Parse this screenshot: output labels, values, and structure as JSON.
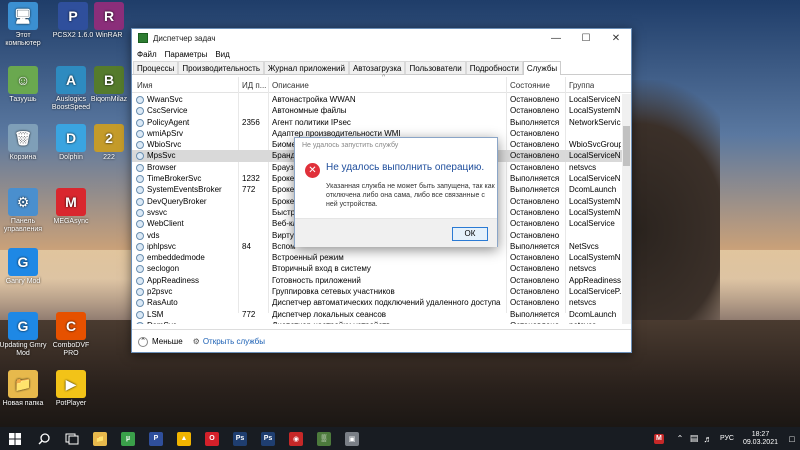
{
  "desktop": {
    "icons": [
      {
        "label": "Этот компьютер",
        "glyph": "🖥",
        "color": "#3b8fd1"
      },
      {
        "label": "PCSX2 1.6.0",
        "glyph": "P",
        "color": "#2f4f9c"
      },
      {
        "label": "WinRAR",
        "glyph": "R",
        "color": "#8b2e7a"
      },
      {
        "label": "Тазуушь",
        "glyph": "☺",
        "color": "#6aa84f"
      },
      {
        "label": "Auslogics BoostSpeed",
        "glyph": "A",
        "color": "#2e8bc0"
      },
      {
        "label": "BiqomMilaz",
        "glyph": "B",
        "color": "#557b2c"
      },
      {
        "label": "Корзина",
        "glyph": "🗑",
        "color": "#7f9fb8"
      },
      {
        "label": "Dolphin",
        "glyph": "D",
        "color": "#3aa4e0"
      },
      {
        "label": "222",
        "glyph": "2",
        "color": "#c49b2a"
      },
      {
        "label": "Панель управления",
        "glyph": "⚙",
        "color": "#4a8fce"
      },
      {
        "label": "MEGAsync",
        "glyph": "M",
        "color": "#d9272e"
      },
      {
        "label": "Ganry Mod",
        "glyph": "G",
        "color": "#1e88e5"
      },
      {
        "label": "Updating Gmry Mod",
        "glyph": "G",
        "color": "#1e88e5"
      },
      {
        "label": "ComboDVF PRO",
        "glyph": "C",
        "color": "#e65100"
      },
      {
        "label": "Новая папка",
        "glyph": "📁",
        "color": "#e7b94c"
      },
      {
        "label": "PotPlayer",
        "glyph": "▶",
        "color": "#f2c318"
      }
    ]
  },
  "window": {
    "title": "Диспетчер задач",
    "menu": [
      "Файл",
      "Параметры",
      "Вид"
    ],
    "tabs": [
      "Процессы",
      "Производительность",
      "Журнал приложений",
      "Автозагрузка",
      "Пользователи",
      "Подробности",
      "Службы"
    ],
    "active_tab": "Службы",
    "columns": {
      "name": "Имя",
      "pid": "ИД п...",
      "desc": "Описание",
      "state": "Состояние",
      "group": "Группа"
    },
    "rows": [
      {
        "name": "WwanSvc",
        "pid": "",
        "desc": "Автонастройка WWAN",
        "state": "Остановлено",
        "group": "LocalServiceN..."
      },
      {
        "name": "CscService",
        "pid": "",
        "desc": "Автономные файлы",
        "state": "Остановлено",
        "group": "LocalSystemN..."
      },
      {
        "name": "PolicyAgent",
        "pid": "2356",
        "desc": "Агент политики IPsec",
        "state": "Выполняется",
        "group": "NetworkServic..."
      },
      {
        "name": "wmiApSrv",
        "pid": "",
        "desc": "Адаптер производительности WMI",
        "state": "Остановлено",
        "group": ""
      },
      {
        "name": "WbioSrvc",
        "pid": "",
        "desc": "Биоме",
        "state": "Остановлено",
        "group": "WbioSvcGroup"
      },
      {
        "name": "MpsSvc",
        "pid": "",
        "desc": "Брандм",
        "state": "Остановлено",
        "group": "LocalServiceN..."
      },
      {
        "name": "Browser",
        "pid": "",
        "desc": "Браузер",
        "state": "Остановлено",
        "group": "netsvcs"
      },
      {
        "name": "TimeBrokerSvc",
        "pid": "1232",
        "desc": "Брокер",
        "state": "Выполняется",
        "group": "LocalServiceN..."
      },
      {
        "name": "SystemEventsBroker",
        "pid": "772",
        "desc": "Брокер",
        "state": "Выполняется",
        "group": "DcomLaunch"
      },
      {
        "name": "DevQueryBroker",
        "pid": "",
        "desc": "Брокер",
        "state": "Остановлено",
        "group": "LocalSystemN..."
      },
      {
        "name": "svsvc",
        "pid": "",
        "desc": "Быстра",
        "state": "Остановлено",
        "group": "LocalSystemN..."
      },
      {
        "name": "WebClient",
        "pid": "",
        "desc": "Веб-кл",
        "state": "Остановлено",
        "group": "LocalService"
      },
      {
        "name": "vds",
        "pid": "",
        "desc": "Вирту",
        "state": "Остановлено",
        "group": ""
      },
      {
        "name": "iphlpsvc",
        "pid": "84",
        "desc": "Вспом",
        "state": "Выполняется",
        "group": "NetSvcs"
      },
      {
        "name": "embeddedmode",
        "pid": "",
        "desc": "Встроенный режим",
        "state": "Остановлено",
        "group": "LocalSystemN..."
      },
      {
        "name": "seclogon",
        "pid": "",
        "desc": "Вторичный вход в систему",
        "state": "Остановлено",
        "group": "netsvcs"
      },
      {
        "name": "AppReadiness",
        "pid": "",
        "desc": "Готовность приложений",
        "state": "Остановлено",
        "group": "AppReadiness"
      },
      {
        "name": "p2psvc",
        "pid": "",
        "desc": "Группировка сетевых участников",
        "state": "Остановлено",
        "group": "LocalServiceP..."
      },
      {
        "name": "RasAuto",
        "pid": "",
        "desc": "Диспетчер автоматических подключений удаленного доступа",
        "state": "Остановлено",
        "group": "netsvcs"
      },
      {
        "name": "LSM",
        "pid": "772",
        "desc": "Диспетчер локальных сеансов",
        "state": "Выполняется",
        "group": "DcomLaunch"
      },
      {
        "name": "DsmSvc",
        "pid": "",
        "desc": "Диспетчер настройки устройств",
        "state": "Остановлено",
        "group": "netsvcs"
      }
    ],
    "selected_row": 5,
    "footer": {
      "less": "Меньше",
      "open_services": "Открыть службы"
    }
  },
  "dialog": {
    "title": "Не удалось запустить службу",
    "heading": "Не удалось выполнить операцию.",
    "message": "Указанная служба не может быть запущена, так как отключена либо она сама, либо все связанные с ней устройства.",
    "ok": "ОК"
  },
  "taskbar": {
    "apps": [
      {
        "name": "file-explorer",
        "glyph": "📁",
        "color": "#e7b94c"
      },
      {
        "name": "utorrent",
        "glyph": "µ",
        "color": "#3aa04a"
      },
      {
        "name": "pcsx2",
        "glyph": "P",
        "color": "#2f4f9c"
      },
      {
        "name": "app-yellow",
        "glyph": "▲",
        "color": "#f0b400"
      },
      {
        "name": "opera",
        "glyph": "O",
        "color": "#d4202a"
      },
      {
        "name": "photoshop-1",
        "glyph": "Ps",
        "color": "#1f3e70"
      },
      {
        "name": "photoshop-2",
        "glyph": "Ps",
        "color": "#1f3e70"
      },
      {
        "name": "red-app",
        "glyph": "◉",
        "color": "#c62828"
      },
      {
        "name": "task-manager",
        "glyph": "▒",
        "color": "#4c7a3c"
      },
      {
        "name": "gray-app",
        "glyph": "▣",
        "color": "#7a7f86"
      }
    ],
    "language": "РУС",
    "time": "18:27",
    "date": "09.03.2021"
  }
}
